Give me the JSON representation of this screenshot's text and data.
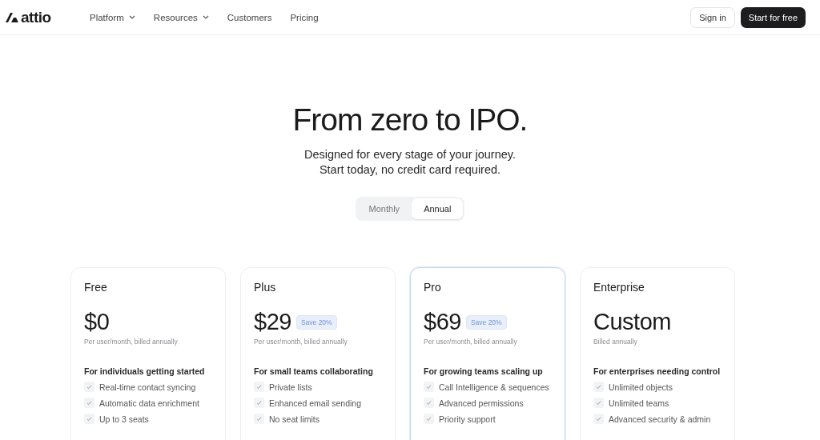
{
  "nav": {
    "logo": "attio",
    "links": [
      {
        "label": "Platform",
        "dropdown": true
      },
      {
        "label": "Resources",
        "dropdown": true
      },
      {
        "label": "Customers",
        "dropdown": false
      },
      {
        "label": "Pricing",
        "dropdown": false
      }
    ],
    "sign_in": "Sign in",
    "cta": "Start for free"
  },
  "hero": {
    "title": "From zero to IPO.",
    "subtitle_lines": [
      "Designed for every stage of your journey.",
      "Start today, no credit card required."
    ]
  },
  "billing_toggle": [
    {
      "label": "Monthly",
      "selected": false
    },
    {
      "label": "Annual",
      "selected": true
    }
  ],
  "plans": [
    {
      "name": "Free",
      "price": "$0",
      "billing": "Per user/month, billed annually",
      "highlighted": false,
      "tagline": "For individuals getting started",
      "features": [
        "Real-time contact syncing",
        "Automatic data enrichment",
        "Up to 3 seats"
      ]
    },
    {
      "name": "Plus",
      "price": "$29",
      "badge": "Save 20%",
      "billing": "Per user/month, billed annually",
      "highlighted": false,
      "tagline": "For small teams collaborating",
      "features": [
        "Private lists",
        "Enhanced email sending",
        "No seat limits"
      ]
    },
    {
      "name": "Pro",
      "price": "$69",
      "badge": "Save 20%",
      "billing": "Per user/month, billed annually",
      "highlighted": true,
      "tagline": "For growing teams scaling up",
      "features": [
        "Call Intelligence & sequences",
        "Advanced permissions",
        "Priority support"
      ]
    },
    {
      "name": "Enterprise",
      "price": "Custom",
      "billing": "Billed annually",
      "highlighted": false,
      "tagline": "For enterprises needing control",
      "features": [
        "Unlimited objects",
        "Unlimited teams",
        "Advanced security & admin"
      ]
    }
  ]
}
